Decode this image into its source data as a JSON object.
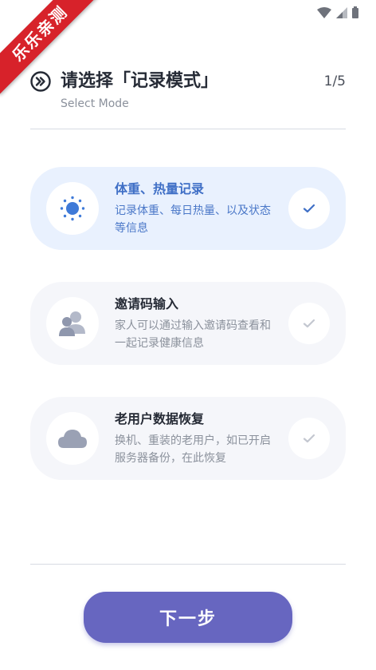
{
  "watermark": {
    "text": "乐乐亲测"
  },
  "header": {
    "title": "请选择「记录模式」",
    "subtitle": "Select Mode",
    "step": "1/5"
  },
  "options": [
    {
      "title": "体重、热量记录",
      "desc": "记录体重、每日热量、以及状态等信息",
      "icon": "sun-icon",
      "selected": true
    },
    {
      "title": "邀请码输入",
      "desc": "家人可以通过输入邀请码查看和一起记录健康信息",
      "icon": "people-icon",
      "selected": false
    },
    {
      "title": "老用户数据恢复",
      "desc": "换机、重装的老用户，如已开启服务器备份，在此恢复",
      "icon": "cloud-icon",
      "selected": false
    }
  ],
  "footer": {
    "next_label": "下一步"
  },
  "colors": {
    "accent": "#6766c0",
    "selected_bg": "#e9f1fe",
    "selected_text": "#3f6fc6",
    "card_bg": "#f5f6fa",
    "ribbon": "#d7222a"
  }
}
